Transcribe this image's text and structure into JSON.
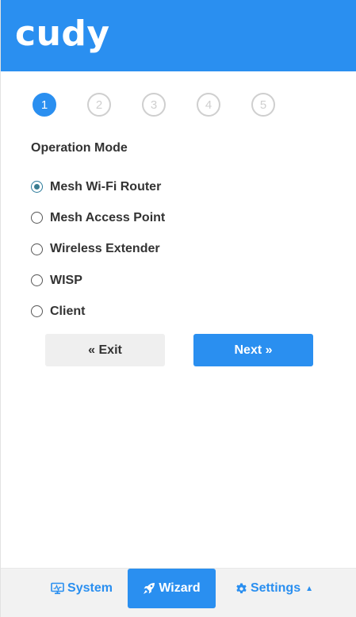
{
  "header": {
    "logo_text": "cudy",
    "brand_color": "#2a8ff0"
  },
  "steps": [
    {
      "label": "1",
      "active": true
    },
    {
      "label": "2",
      "active": false
    },
    {
      "label": "3",
      "active": false
    },
    {
      "label": "4",
      "active": false
    },
    {
      "label": "5",
      "active": false
    }
  ],
  "section": {
    "title": "Operation Mode"
  },
  "options": [
    {
      "label": "Mesh Wi-Fi Router",
      "checked": true
    },
    {
      "label": "Mesh Access Point",
      "checked": false
    },
    {
      "label": "Wireless Extender",
      "checked": false
    },
    {
      "label": "WISP",
      "checked": false
    },
    {
      "label": "Client",
      "checked": false
    }
  ],
  "buttons": {
    "exit_label": "« Exit",
    "next_label": "Next »"
  },
  "footer": {
    "system_label": "System",
    "system_icon": "monitor-icon",
    "wizard_label": "Wizard",
    "wizard_icon": "rocket-icon",
    "settings_label": "Settings",
    "settings_icon": "gear-icon",
    "active": "Wizard"
  }
}
